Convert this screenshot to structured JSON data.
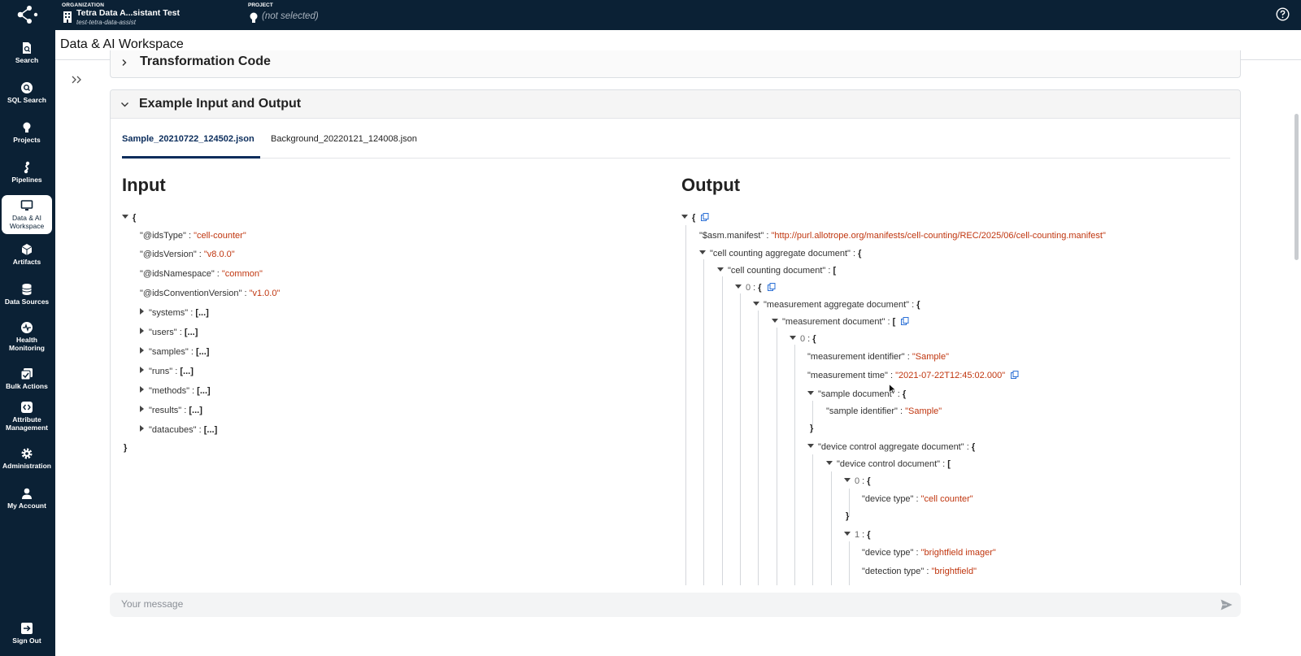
{
  "topbar": {
    "org_caption": "ORGANIZATION",
    "org_name": "Tetra Data A...sistant Test",
    "org_slug": "test-tetra-data-assist",
    "project_caption": "PROJECT",
    "project_name": "(not selected)"
  },
  "sidebar": {
    "items": [
      {
        "label": "Search",
        "icon": "search-doc-icon"
      },
      {
        "label": "SQL Search",
        "icon": "sql-search-icon"
      },
      {
        "label": "Projects",
        "icon": "lightbulb-icon"
      },
      {
        "label": "Pipelines",
        "icon": "pipeline-icon"
      },
      {
        "label": "Data & AI Workspace",
        "icon": "monitor-icon",
        "active": true
      },
      {
        "label": "Artifacts",
        "icon": "cube-icon"
      },
      {
        "label": "Data Sources",
        "icon": "database-icon"
      },
      {
        "label": "Health Monitoring",
        "icon": "heartbeat-icon"
      },
      {
        "label": "Bulk Actions",
        "icon": "bulk-check-icon"
      },
      {
        "label": "Attribute Management",
        "icon": "code-brackets-icon"
      },
      {
        "label": "Administration",
        "icon": "gear-icon"
      },
      {
        "label": "My Account",
        "icon": "user-icon"
      },
      {
        "label": "Sign Out",
        "icon": "sign-out-icon"
      }
    ]
  },
  "page": {
    "title": "Data & AI Workspace"
  },
  "sections": {
    "transformation": "Transformation Code",
    "example": "Example Input and Output"
  },
  "tabs": [
    "Sample_20210722_124502.json",
    "Background_20220121_124008.json"
  ],
  "input": {
    "title": "Input",
    "open": "{",
    "close": "}",
    "fields": [
      {
        "key": "\"@idsType\"",
        "value": "\"cell-counter\""
      },
      {
        "key": "\"@idsVersion\"",
        "value": "\"v8.0.0\""
      },
      {
        "key": "\"@idsNamespace\"",
        "value": "\"common\""
      },
      {
        "key": "\"@idsConventionVersion\"",
        "value": "\"v1.0.0\""
      }
    ],
    "collapsed": [
      {
        "key": "\"systems\"",
        "value": "[...]"
      },
      {
        "key": "\"users\"",
        "value": "[...]"
      },
      {
        "key": "\"samples\"",
        "value": "[...]"
      },
      {
        "key": "\"runs\"",
        "value": "[...]"
      },
      {
        "key": "\"methods\"",
        "value": "[...]"
      },
      {
        "key": "\"results\"",
        "value": "[...]"
      },
      {
        "key": "\"datacubes\"",
        "value": "[...]"
      }
    ]
  },
  "output": {
    "title": "Output",
    "lines": [
      {
        "k": "",
        "v": "{"
      },
      {
        "k": "\"$asm.manifest\"",
        "v": "\"http://purl.allotrope.org/manifests/cell-counting/REC/2025/06/cell-counting.manifest\""
      },
      {
        "k": "\"cell counting aggregate document\"",
        "v": "{"
      },
      {
        "k": "\"cell counting document\"",
        "v": "["
      },
      {
        "k": "0",
        "v": "{"
      },
      {
        "k": "\"measurement aggregate document\"",
        "v": "{"
      },
      {
        "k": "\"measurement document\"",
        "v": "["
      },
      {
        "k": "0",
        "v": "{"
      },
      {
        "k": "\"measurement identifier\"",
        "v": "\"Sample\""
      },
      {
        "k": "\"measurement time\"",
        "v": "\"2021-07-22T12:45:02.000\""
      },
      {
        "k": "\"sample document\"",
        "v": "{"
      },
      {
        "k": "\"sample identifier\"",
        "v": "\"Sample\""
      },
      {
        "k": "",
        "v": "}"
      },
      {
        "k": "\"device control aggregate document\"",
        "v": "{"
      },
      {
        "k": "\"device control document\"",
        "v": "["
      },
      {
        "k": "0",
        "v": "{"
      },
      {
        "k": "\"device type\"",
        "v": "\"cell counter\""
      },
      {
        "k": "",
        "v": "}"
      },
      {
        "k": "1",
        "v": "{"
      },
      {
        "k": "\"device type\"",
        "v": "\"brightfield imager\""
      },
      {
        "k": "\"detection type\"",
        "v": "\"brightfield\""
      }
    ]
  },
  "message": {
    "placeholder": "Your message"
  },
  "colors": {
    "nav": "#0b2135",
    "value": "#c0360f",
    "tab_active": "#0b2d5c"
  }
}
